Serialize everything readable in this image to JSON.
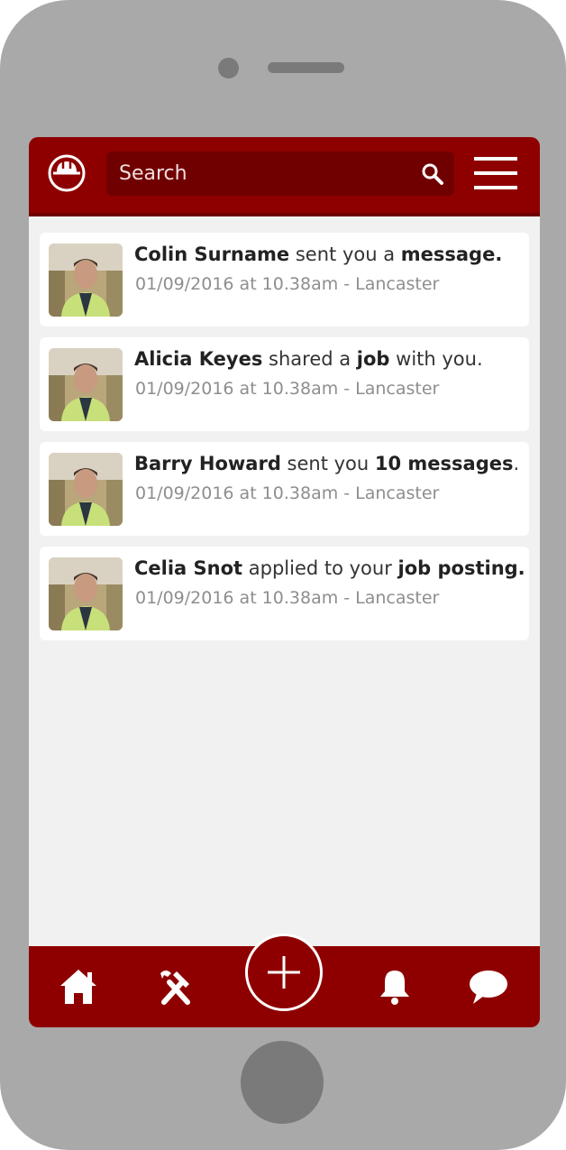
{
  "colors": {
    "brand": "#8e0000",
    "brand_dark": "#700000",
    "phone_body": "#a9a9a9",
    "screen_bg": "#f1f1f1",
    "muted_text": "#8e8e8e"
  },
  "header": {
    "logo_icon": "hard-hat-icon",
    "search": {
      "placeholder": "Search",
      "icon": "search-icon"
    },
    "menu_icon": "hamburger-menu-icon"
  },
  "notifications": [
    {
      "name": "Colin Surname",
      "before": " sent you a ",
      "emphasis": "message.",
      "after": "",
      "meta": "01/09/2016 at 10.38am - Lancaster"
    },
    {
      "name": "Alicia Keyes",
      "before": " shared a ",
      "emphasis": "job",
      "after": " with you.",
      "meta": "01/09/2016 at 10.38am - Lancaster"
    },
    {
      "name": "Barry Howard",
      "before": " sent you ",
      "emphasis": "10 messages",
      "after": ".",
      "meta": "01/09/2016 at 10.38am - Lancaster"
    },
    {
      "name": "Celia Snot",
      "before": " applied to your ",
      "emphasis": "job posting.",
      "after": "",
      "meta": "01/09/2016 at 10.38am - Lancaster"
    }
  ],
  "bottom_nav": {
    "items": [
      "home-icon",
      "tools-icon",
      "add-icon",
      "bell-icon",
      "chat-icon"
    ]
  }
}
